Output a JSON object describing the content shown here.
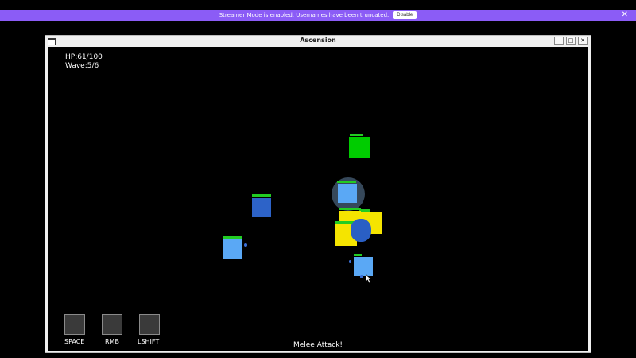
{
  "banner": {
    "message": "Streamer Mode is enabled. Usernames have been truncated.",
    "disable_label": "Disable",
    "close_glyph": "✕",
    "color": "#8b5cf6"
  },
  "window": {
    "title": "Ascension",
    "minimize_glyph": "–",
    "maximize_glyph": "□",
    "close_glyph": "✕",
    "icon": "window-icon"
  },
  "hud": {
    "hp": "HP:61/100",
    "wave": "Wave:5/6"
  },
  "abilities": [
    {
      "key": "SPACE"
    },
    {
      "key": "RMB"
    },
    {
      "key": "LSHIFT"
    }
  ],
  "status": "Melee Attack!",
  "colors": {
    "enemy_green": "#00cc00",
    "enemy_yellow": "#f5e400",
    "enemy_lightblue": "#5aa8f5",
    "enemy_darkblue": "#2d63c8",
    "player": "#2a5fc4",
    "health_bar": "#22cc22"
  }
}
